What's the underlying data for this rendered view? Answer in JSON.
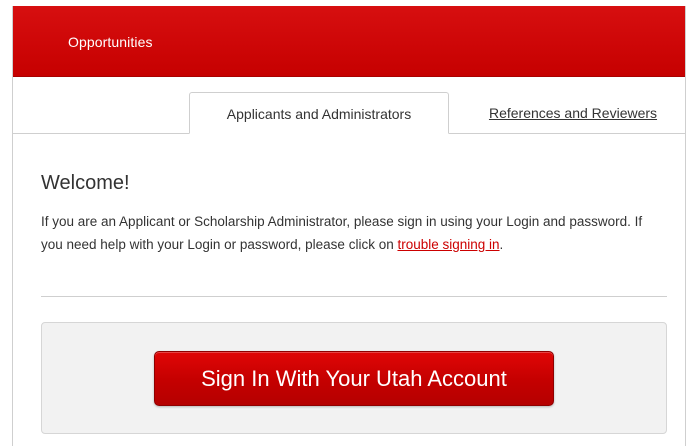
{
  "nav": {
    "opportunities_label": "Opportunities"
  },
  "tabs": [
    {
      "label": "Applicants and Administrators",
      "active": true
    },
    {
      "label": "References and Reviewers",
      "active": false
    }
  ],
  "main": {
    "welcome_title": "Welcome!",
    "intro_text_before_link": "If you are an Applicant or Scholarship Administrator, please sign in using your Login and password. If you need help with your Login or password, please click on ",
    "trouble_link_label": "trouble signing in",
    "intro_text_after_link": ".",
    "signin_button_label": "Sign In With Your Utah Account"
  },
  "colors": {
    "brand_red": "#cc0000",
    "link_red": "#cc0000",
    "panel_gray": "#f2f2f2"
  }
}
